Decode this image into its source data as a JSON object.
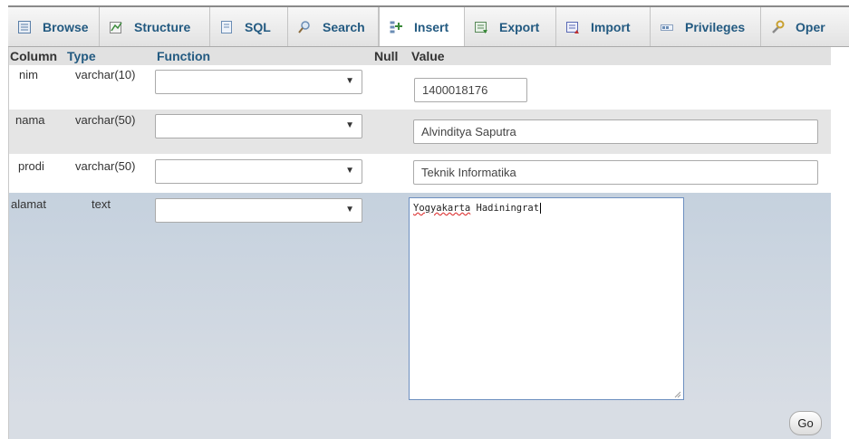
{
  "tabs": [
    {
      "label": "Browse",
      "icon": "browse-icon"
    },
    {
      "label": "Structure",
      "icon": "structure-icon"
    },
    {
      "label": "SQL",
      "icon": "sql-icon"
    },
    {
      "label": "Search",
      "icon": "search-icon"
    },
    {
      "label": "Insert",
      "icon": "insert-icon",
      "active": true
    },
    {
      "label": "Export",
      "icon": "export-icon"
    },
    {
      "label": "Import",
      "icon": "import-icon"
    },
    {
      "label": "Privileges",
      "icon": "privileges-icon"
    },
    {
      "label": "Oper",
      "icon": "operations-icon"
    }
  ],
  "table": {
    "headers": {
      "column": "Column",
      "type": "Type",
      "function": "Function",
      "null": "Null",
      "value": "Value"
    },
    "rows": [
      {
        "column": "nim",
        "type": "varchar(10)",
        "function": "",
        "value": "1400018176"
      },
      {
        "column": "nama",
        "type": "varchar(50)",
        "function": "",
        "value": "Alvinditya Saputra"
      },
      {
        "column": "prodi",
        "type": "varchar(50)",
        "function": "",
        "value": "Teknik Informatika"
      },
      {
        "column": "alamat",
        "type": "text",
        "function": "",
        "value_word1": "Yogyakarta",
        "value_rest": " Hadiningrat"
      }
    ]
  },
  "go_label": "Go",
  "colors": {
    "tab_text": "#235a81",
    "row_white": "#ffffff",
    "row_gray": "#e5e5e5",
    "row_blue_top": "#c5d1de",
    "row_blue_bottom": "#d8dde4"
  }
}
